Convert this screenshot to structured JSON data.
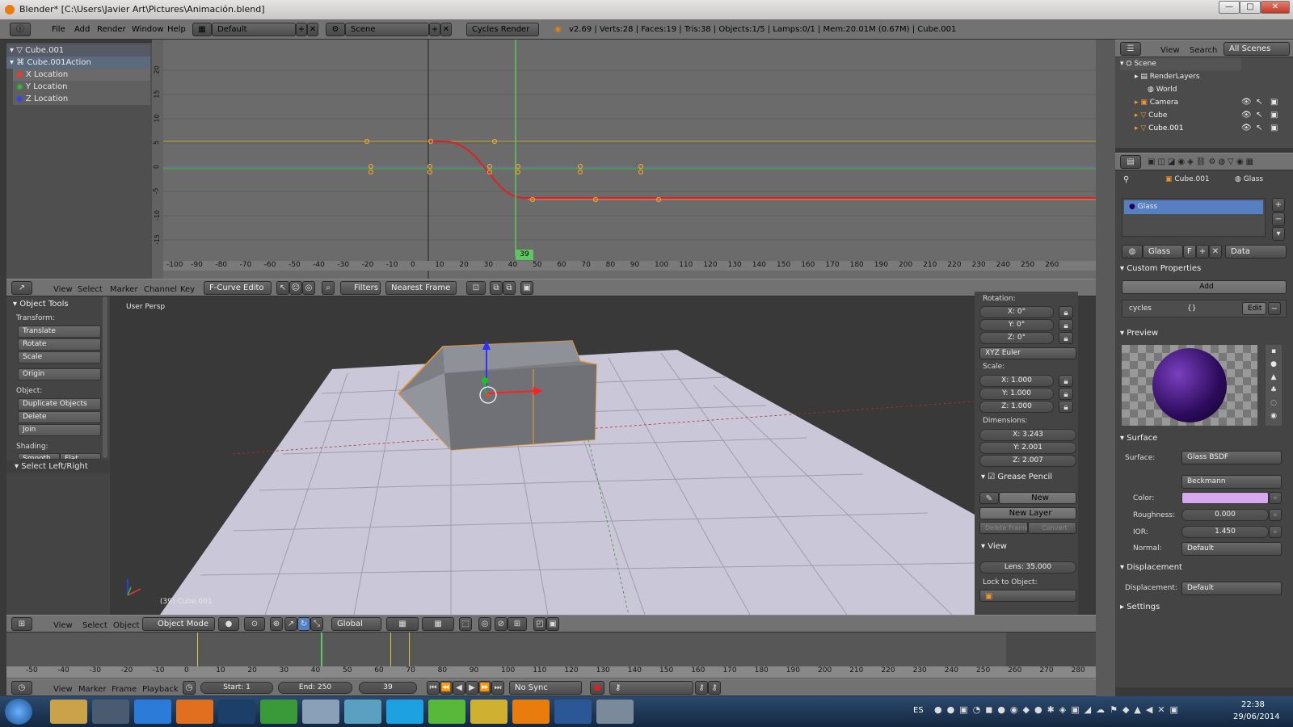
{
  "window": {
    "title": "Blender* [C:\\Users\\Javier Art\\Pictures\\Animación.blend]",
    "min": "—",
    "max": "□",
    "close": "✕"
  },
  "info": {
    "menus": [
      "File",
      "Add",
      "Render",
      "Window",
      "Help"
    ],
    "screen": "Default",
    "scene": "Scene",
    "engine": "Cycles Render",
    "stats": "v2.69 | Verts:28 | Faces:19 | Tris:38 | Objects:1/5 | Lamps:0/1 | Mem:20.01M (0.67M) | Cube.001"
  },
  "graph": {
    "channels": [
      "Cube.001",
      "Cube.001Action",
      "X Location",
      "Y Location",
      "Z Location"
    ],
    "frame_badge": "39",
    "y_ticks": [
      "20",
      "15",
      "10",
      "5",
      "0",
      "-5",
      "-10",
      "-15"
    ],
    "x_ticks": [
      "-100",
      "-90",
      "-80",
      "-70",
      "-60",
      "-50",
      "-40",
      "-30",
      "-20",
      "-10",
      "0",
      "10",
      "20",
      "30",
      "40",
      "50",
      "60",
      "70",
      "80",
      "90",
      "100",
      "110",
      "120",
      "130",
      "140",
      "150",
      "160",
      "170",
      "180",
      "190",
      "200",
      "210",
      "220",
      "230",
      "240",
      "250",
      "260"
    ]
  },
  "graph_header": {
    "menus": [
      "View",
      "Select",
      "Marker",
      "Channel",
      "Key"
    ],
    "mode": "F-Curve Edito",
    "filters": "Filters",
    "snap": "Nearest Frame"
  },
  "tools": {
    "title": "Object Tools",
    "transform_label": "Transform:",
    "buttons": [
      "Translate",
      "Rotate",
      "Scale"
    ],
    "origin": "Origin",
    "object_label": "Object:",
    "object_buttons": [
      "Duplicate Objects",
      "Delete",
      "Join"
    ],
    "shading_label": "Shading:",
    "smooth": "Smooth",
    "flat": "Flat",
    "select_lr": "Select Left/Right"
  },
  "viewport": {
    "label": "User Persp",
    "status": "(39) Cube.001"
  },
  "nprops": {
    "rotation_label": "Rotation:",
    "rotation": [
      "X: 0°",
      "Y: 0°",
      "Z: 0°"
    ],
    "euler": "XYZ Euler",
    "scale_label": "Scale:",
    "scale": [
      "X: 1.000",
      "Y: 1.000",
      "Z: 1.000"
    ],
    "dims_label": "Dimensions:",
    "dims": [
      "X: 3.243",
      "Y: 2.001",
      "Z: 2.007"
    ],
    "grease": "Grease Pencil",
    "new": "New",
    "new_layer": "New Layer",
    "delete_frame": "Delete Frame",
    "convert": "Convert",
    "view": "View",
    "lens": "Lens: 35.000",
    "lock": "Lock to Object:"
  },
  "v3d_header": {
    "menus": [
      "View",
      "Select",
      "Object"
    ],
    "mode": "Object Mode",
    "orientation": "Global"
  },
  "timeline": {
    "ticks": [
      "-50",
      "-40",
      "-30",
      "-20",
      "-10",
      "0",
      "10",
      "20",
      "30",
      "40",
      "50",
      "60",
      "70",
      "80",
      "90",
      "100",
      "110",
      "120",
      "130",
      "140",
      "150",
      "160",
      "170",
      "180",
      "190",
      "200",
      "210",
      "220",
      "230",
      "240",
      "250",
      "260",
      "270",
      "280"
    ],
    "menus": [
      "View",
      "Marker",
      "Frame",
      "Playback"
    ],
    "start": "Start: 1",
    "end": "End: 250",
    "current": "39",
    "sync": "No Sync"
  },
  "outliner": {
    "menus": [
      "View",
      "Search"
    ],
    "filter": "All Scenes",
    "items": [
      "Scene",
      "RenderLayers",
      "World",
      "Camera",
      "Cube",
      "Cube.001"
    ]
  },
  "props": {
    "breadcrumb_obj": "Cube.001",
    "breadcrumb_mat": "Glass",
    "slot": "Glass",
    "mat_name": "Glass",
    "mat_f": "F",
    "link": "Data",
    "custom_props": "Custom Properties",
    "add": "Add",
    "cycles": "cycles",
    "cycles_val": "{}",
    "edit": "Edit",
    "preview": "Preview",
    "surface_sec": "Surface",
    "surface_label": "Surface:",
    "surface_val": "Glass BSDF",
    "distribution": "Beckmann",
    "color_label": "Color:",
    "rough_label": "Roughness:",
    "rough_val": "0.000",
    "ior_label": "IOR:",
    "ior_val": "1.450",
    "normal_label": "Normal:",
    "normal_val": "Default",
    "displacement_sec": "Displacement",
    "displacement_label": "Displacement:",
    "displacement_val": "Default",
    "settings": "Settings"
  },
  "taskbar": {
    "lang": "ES",
    "time": "22:38",
    "date": "29/06/2014"
  },
  "colors": {
    "x": "#ff3030",
    "y": "#30c030",
    "z": "#3040ff",
    "frame": "#62c462",
    "select": "#f0a030"
  }
}
